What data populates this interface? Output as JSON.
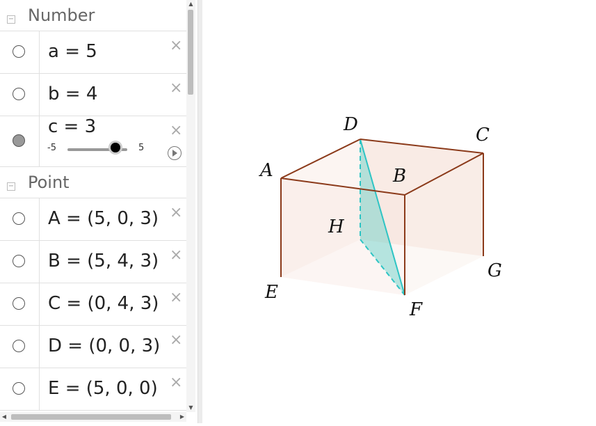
{
  "algebra": {
    "groups": [
      {
        "title": "Number"
      },
      {
        "title": "Point"
      }
    ],
    "numbers": [
      {
        "expr": "a = 5"
      },
      {
        "expr": "b = 4"
      },
      {
        "expr": "c = 3",
        "slider_min": "-5",
        "slider_max": "5",
        "slider_value": 3
      }
    ],
    "points": [
      {
        "expr": "A = (5, 0, 3)"
      },
      {
        "expr": "B = (5, 4, 3)"
      },
      {
        "expr": "C = (0, 4, 3)"
      },
      {
        "expr": "D = (0, 0, 3)"
      },
      {
        "expr": "E = (5, 0, 0)"
      }
    ],
    "delete_symbol": "×",
    "collapse_symbol": "−"
  },
  "graphics": {
    "labels": {
      "A": "A",
      "B": "B",
      "C": "C",
      "D": "D",
      "E": "E",
      "F": "F",
      "G": "G",
      "H": "H"
    },
    "colors": {
      "edge": "#8b3a1a",
      "face": "#f5e3dc",
      "triangle_fill": "#5fd0c8",
      "triangle_edge": "#2ec4c4"
    }
  }
}
